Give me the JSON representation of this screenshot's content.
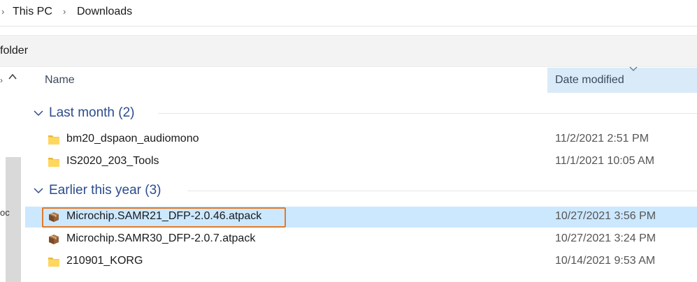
{
  "breadcrumb": {
    "items": [
      "This PC",
      "Downloads"
    ]
  },
  "command_bar": {
    "partial_label": "folder"
  },
  "nav": {
    "truncated_text": "oc"
  },
  "columns": {
    "name": "Name",
    "date_modified": "Date modified"
  },
  "groups": [
    {
      "label": "Last month (2)",
      "items": [
        {
          "name": "bm20_dspaon_audiomono",
          "date": "11/2/2021 2:51 PM",
          "type": "folder",
          "selected": false
        },
        {
          "name": "IS2020_203_Tools",
          "date": "11/1/2021 10:05 AM",
          "type": "folder",
          "selected": false
        }
      ]
    },
    {
      "label": "Earlier this year (3)",
      "items": [
        {
          "name": "Microchip.SAMR21_DFP-2.0.46.atpack",
          "date": "10/27/2021 3:56 PM",
          "type": "package",
          "selected": true
        },
        {
          "name": "Microchip.SAMR30_DFP-2.0.7.atpack",
          "date": "10/27/2021 3:24 PM",
          "type": "package",
          "selected": false
        },
        {
          "name": "210901_KORG",
          "date": "10/14/2021 9:53 AM",
          "type": "folder",
          "selected": false
        }
      ]
    }
  ],
  "colors": {
    "selection": "#cce8ff",
    "focus_outline": "#e07b2a",
    "group_header": "#2b4c8c",
    "column_header_active": "#d9ebf9",
    "folder_yellow": "#ffd75e"
  }
}
